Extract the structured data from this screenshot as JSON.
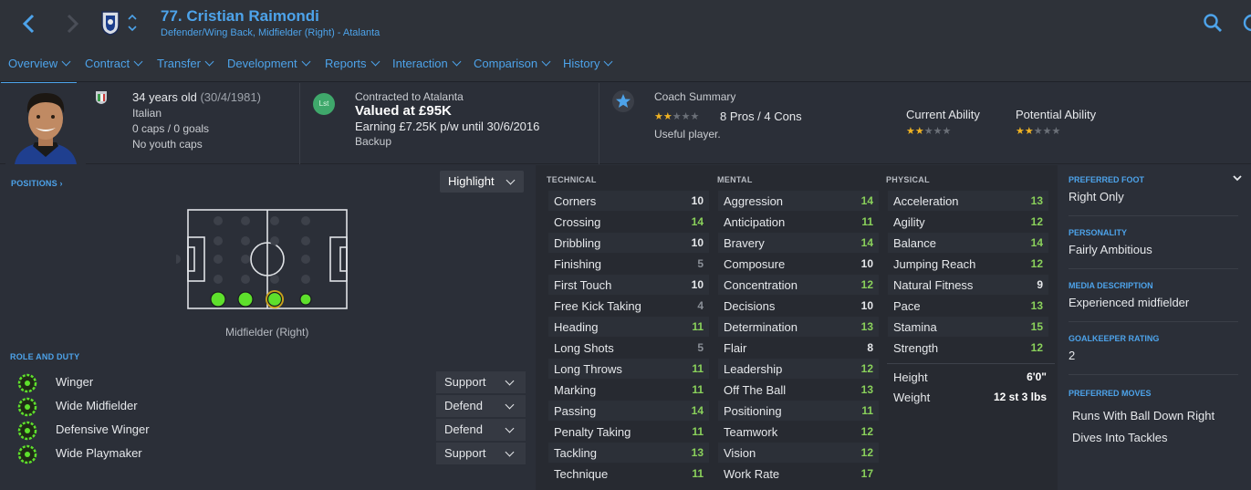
{
  "header": {
    "title": "77. Cristian Raimondi",
    "subtitle": "Defender/Wing Back, Midfielder (Right) - Atalanta"
  },
  "tabs": [
    {
      "label": "Overview",
      "active": true
    },
    {
      "label": "Contract"
    },
    {
      "label": "Transfer"
    },
    {
      "label": "Development"
    },
    {
      "label": "Reports"
    },
    {
      "label": "Interaction"
    },
    {
      "label": "Comparison"
    },
    {
      "label": "History"
    }
  ],
  "bio": {
    "age_line": "34 years old",
    "dob": "(30/4/1981)",
    "nationality": "Italian",
    "caps": "0 caps / 0 goals",
    "youth": "No youth caps"
  },
  "contract": {
    "badge": "Lst",
    "contracted_to": "Contracted to Atalanta",
    "value": "Valued at £95K",
    "earning": "Earning £7.25K p/w until 30/6/2016",
    "status": "Backup"
  },
  "coach": {
    "label": "Coach Summary",
    "stars": 2,
    "pros_cons": "8 Pros / 4 Cons",
    "comment": "Useful player."
  },
  "ability": {
    "current_label": "Current Ability",
    "current_stars": 2,
    "potential_label": "Potential Ability",
    "potential_stars": 2
  },
  "positions": {
    "label": "POSITIONS",
    "highlight": "Highlight",
    "caption": "Midfielder (Right)"
  },
  "roles": {
    "label": "ROLE AND DUTY",
    "items": [
      {
        "name": "Winger",
        "duty": "Support"
      },
      {
        "name": "Wide Midfielder",
        "duty": "Defend"
      },
      {
        "name": "Defensive Winger",
        "duty": "Defend"
      },
      {
        "name": "Wide Playmaker",
        "duty": "Support"
      }
    ]
  },
  "attributes": {
    "technical_label": "TECHNICAL",
    "mental_label": "MENTAL",
    "physical_label": "PHYSICAL",
    "technical": [
      {
        "name": "Corners",
        "value": "10"
      },
      {
        "name": "Crossing",
        "value": "14"
      },
      {
        "name": "Dribbling",
        "value": "10"
      },
      {
        "name": "Finishing",
        "value": "5"
      },
      {
        "name": "First Touch",
        "value": "10"
      },
      {
        "name": "Free Kick Taking",
        "value": "4"
      },
      {
        "name": "Heading",
        "value": "11"
      },
      {
        "name": "Long Shots",
        "value": "5"
      },
      {
        "name": "Long Throws",
        "value": "11"
      },
      {
        "name": "Marking",
        "value": "11"
      },
      {
        "name": "Passing",
        "value": "14"
      },
      {
        "name": "Penalty Taking",
        "value": "11"
      },
      {
        "name": "Tackling",
        "value": "13"
      },
      {
        "name": "Technique",
        "value": "11"
      }
    ],
    "mental": [
      {
        "name": "Aggression",
        "value": "14"
      },
      {
        "name": "Anticipation",
        "value": "11"
      },
      {
        "name": "Bravery",
        "value": "14"
      },
      {
        "name": "Composure",
        "value": "10"
      },
      {
        "name": "Concentration",
        "value": "12"
      },
      {
        "name": "Decisions",
        "value": "10"
      },
      {
        "name": "Determination",
        "value": "13"
      },
      {
        "name": "Flair",
        "value": "8"
      },
      {
        "name": "Leadership",
        "value": "12"
      },
      {
        "name": "Off The Ball",
        "value": "13"
      },
      {
        "name": "Positioning",
        "value": "11"
      },
      {
        "name": "Teamwork",
        "value": "12"
      },
      {
        "name": "Vision",
        "value": "12"
      },
      {
        "name": "Work Rate",
        "value": "17"
      }
    ],
    "physical": [
      {
        "name": "Acceleration",
        "value": "13"
      },
      {
        "name": "Agility",
        "value": "12"
      },
      {
        "name": "Balance",
        "value": "14"
      },
      {
        "name": "Jumping Reach",
        "value": "12"
      },
      {
        "name": "Natural Fitness",
        "value": "9"
      },
      {
        "name": "Pace",
        "value": "13"
      },
      {
        "name": "Stamina",
        "value": "15"
      },
      {
        "name": "Strength",
        "value": "12"
      }
    ],
    "height_label": "Height",
    "height": "6'0\"",
    "weight_label": "Weight",
    "weight": "12 st 3 lbs"
  },
  "profile": {
    "foot_label": "PREFERRED FOOT",
    "foot": "Right Only",
    "personality_label": "PERSONALITY",
    "personality": "Fairly Ambitious",
    "media_label": "MEDIA DESCRIPTION",
    "media": "Experienced midfielder",
    "gk_label": "GOALKEEPER RATING",
    "gk": "2",
    "moves_label": "PREFERRED MOVES",
    "moves": [
      "Runs With Ball Down Right",
      "Dives Into Tackles"
    ]
  },
  "colors": {
    "accent": "#4da3ea",
    "good": "#8ad15b",
    "star": "#f0b323",
    "bg": "#2b2f38"
  }
}
